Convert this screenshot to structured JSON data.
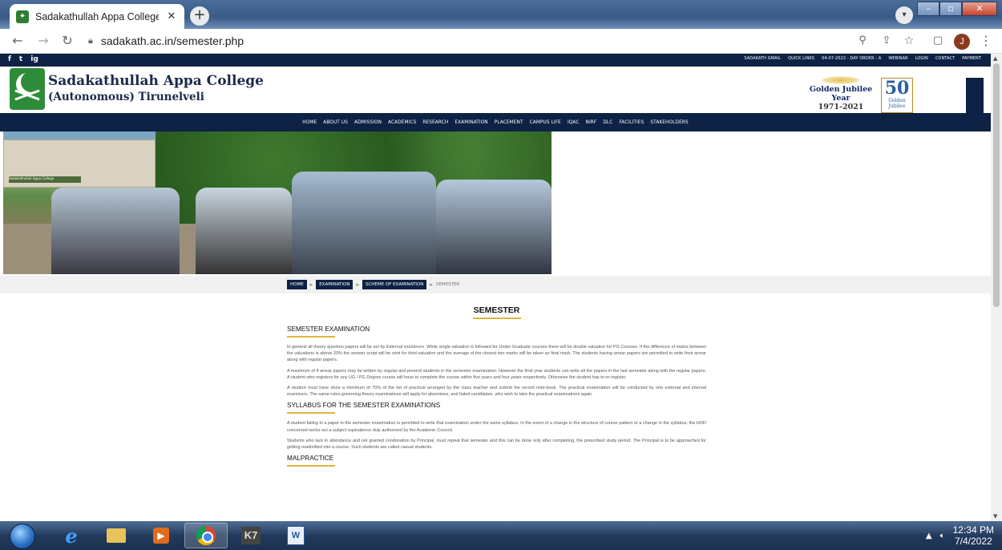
{
  "browser": {
    "tab_title": "Sadakathullah Appa College, Pala",
    "tab_close": "✕",
    "new_tab": "+",
    "url": "sadakath.ac.in/semester.php",
    "avatar_initial": "J"
  },
  "site": {
    "social": [
      "f",
      "t",
      "ig"
    ],
    "top_links": [
      "SADAKATH GMAIL",
      "QUICK LINKS",
      "04-07-2022 - DAY ORDER : A",
      "WEBINAR",
      "LOGIN",
      "CONTACT",
      "PAYMENT"
    ],
    "college_name": "Sadakathullah Appa College",
    "college_sub": "(Autonomous) Tirunelveli",
    "jubilee_line1": "Golden Jubilee Year",
    "jubilee_line2": "1971-2021",
    "fifty": "50",
    "fifty_sub": "Golden Jubilee",
    "nav": [
      "HOME",
      "ABOUT US",
      "ADMISSION",
      "ACADEMICS",
      "RESEARCH",
      "EXAMINATION",
      "PLACEMENT",
      "CAMPUS LIFE",
      "IQAC",
      "NIRF",
      "DLC",
      "FACILITIES",
      "STAKEHOLDERS"
    ],
    "banner_sign": "Sadakathullah Appa College"
  },
  "breadcrumb": {
    "items": [
      "HOME",
      "EXAMINATION",
      "SCHEME OF EXAMINATION"
    ],
    "current": "SEMESTER"
  },
  "content": {
    "title": "SEMESTER",
    "sections": [
      {
        "heading": "SEMESTER EXAMINATION",
        "paragraphs": [
          "In general all theory question papers will be set by External examiners. While single valuation is followed for Under Graduate courses there will be double valuation for PG Courses. If the difference of marks between the valuations is above 20% the answer script will be sent for third valuation and the average of the closest two marks will be taken as final mark. The students having arrear papers are permitted to write their arrear along with regular papers.",
          "A maximum of 4 arrear papers may be written by regular and present students in the semester examination. However the final year students can write all the papers in the last semester along with the regular papers. A student who registers for any UG / PG Degree course will have to complete the course within five years and four years respectively. Otherwise the student has to re-register.",
          "A student must have done a minimum of 75% of the list of practical arranged by the class teacher and submit the record note-book. The practical examination will be conducted by one external and internal examiners. The same rules governing theory examinations will apply for absentees, and failed candidates, who wish to take the practical examinations again."
        ]
      },
      {
        "heading": "SYLLABUS FOR THE SEMESTER EXAMINATIONS",
        "paragraphs": [
          "A student failing in a paper in the semester examination is permitted to write that examination under the same syllabus. In the event of a change in the structure of course pattern or a change in the syllabus, the HOD concerned works out a subject equivalence duly authorized by the Academic Council.",
          "Students who lack in attendance and not granted condonation by Principal, must repeat that semester and this can be done only after completing, the prescribed study period. The Principal is to be approached for getting readmitted into a course. Such students are called casual students."
        ]
      },
      {
        "heading": "MALPRACTICE",
        "paragraphs": []
      }
    ]
  },
  "taskbar": {
    "time": "12:34 PM",
    "date": "7/4/2022"
  }
}
